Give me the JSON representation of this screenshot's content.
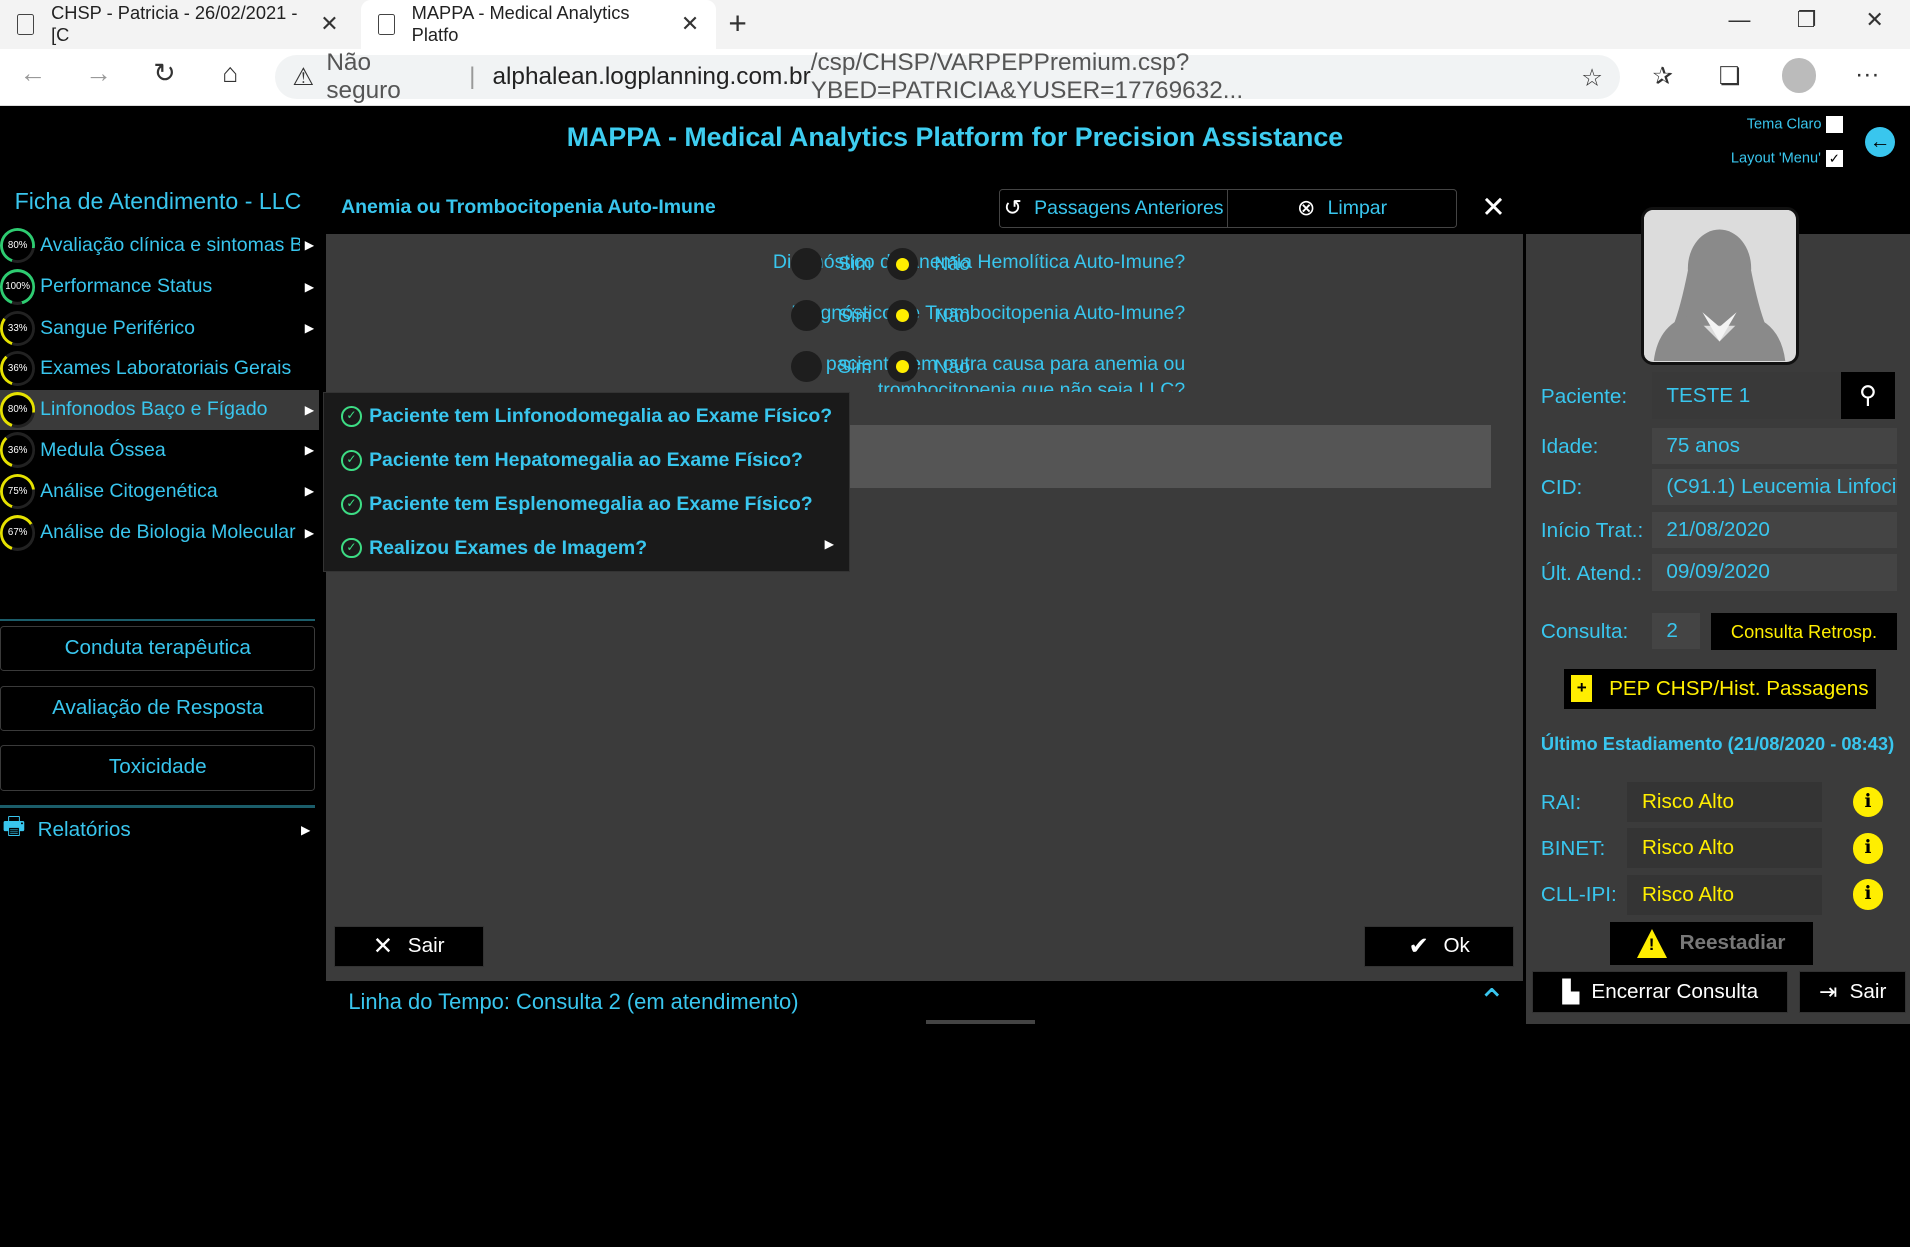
{
  "browser": {
    "tabs": [
      {
        "title": "CHSP - Patricia - 26/02/2021 - [C"
      },
      {
        "title": "MAPPA - Medical Analytics Platfo"
      }
    ],
    "new_tab": "+",
    "minimize": "—",
    "restore": "❐",
    "close": "✕",
    "security": "Não seguro",
    "separator": "|",
    "url_domain": "alphalean.logplanning.com.br",
    "url_path": "/csp/CHSP/VARPEPPremium.csp?YBED=PATRICIA&YUSER=17769632..."
  },
  "app": {
    "title": "MAPPA - Medical Analytics Platform for Precision Assistance",
    "tema_claro": "Tema Claro",
    "layout_menu": "Layout 'Menu'",
    "layout_checked": "✓",
    "accent_color": "#39c6ee",
    "highlight_color": "#ffee00"
  },
  "nav": {
    "title": "Ficha de Atendimento - LLC",
    "items": [
      {
        "pct": "80%",
        "pct_value": 0.8,
        "color": "#2ecc71",
        "label": "Avaliação clínica e sintomas B",
        "arrow": "▶"
      },
      {
        "pct": "100%",
        "pct_value": 1.0,
        "color": "#2ecc71",
        "label": "Performance Status",
        "arrow": "▶"
      },
      {
        "pct": "33%",
        "pct_value": 0.33,
        "color": "#e6e200",
        "label": "Sangue Periférico",
        "arrow": "▶"
      },
      {
        "pct": "36%",
        "pct_value": 0.36,
        "color": "#e6e200",
        "label": "Exames Laboratoriais Gerais",
        "arrow": ""
      },
      {
        "pct": "80%",
        "pct_value": 0.8,
        "color": "#e6e200",
        "label": "Linfonodos Baço e Fígado",
        "arrow": "▶"
      },
      {
        "pct": "36%",
        "pct_value": 0.36,
        "color": "#e6e200",
        "label": "Medula Óssea",
        "arrow": "▶"
      },
      {
        "pct": "75%",
        "pct_value": 0.75,
        "color": "#e6e200",
        "label": "Análise Citogenética",
        "arrow": "▶"
      },
      {
        "pct": "67%",
        "pct_value": 0.67,
        "color": "#e6e200",
        "label": "Análise de Biologia Molecular",
        "arrow": "▶"
      }
    ],
    "buttons": [
      "Conduta terapêutica",
      "Avaliação de Resposta",
      "Toxicidade"
    ],
    "relatorios": "Relatórios",
    "relatorios_arrow": "▶"
  },
  "panel": {
    "title": "Anemia ou Trombocitopenia Auto-Imune",
    "passagens": "Passagens Anteriores",
    "limpar": "Limpar",
    "close": "✕",
    "questions": [
      {
        "text": "Diagnóstico de Anemia Hemolítica Auto-Imune?",
        "yes": "Sim",
        "no": "Não",
        "selected": "Não"
      },
      {
        "text": "Diagnóstico de Trombocitopenia Auto-Imune?",
        "yes": "Sim",
        "no": "Não",
        "selected": "Não"
      },
      {
        "text": "O paciente tem outra causa para anemia ou",
        "text2": "trombocitopenia que não seja LLC?",
        "yes": "Sim",
        "no": "Não",
        "selected": "Não"
      }
    ],
    "submenu": [
      {
        "label": "Paciente tem Linfonodomegalia ao Exame Físico?"
      },
      {
        "label": "Paciente tem Hepatomegalia ao Exame Físico?"
      },
      {
        "label": "Paciente tem Esplenomegalia ao Exame Físico?"
      },
      {
        "label": "Realizou Exames de Imagem?",
        "arrow": "▶"
      }
    ],
    "sair": "Sair",
    "ok": "Ok",
    "timeline": "Linha do Tempo: Consulta 2 (em atendimento)"
  },
  "patient": {
    "paciente_label": "Paciente:",
    "paciente": "TESTE 1",
    "idade_label": "Idade:",
    "idade": "75 anos",
    "cid_label": "CID:",
    "cid": "(C91.1) Leucemia Linfoci",
    "inicio_label": "Início Trat.:",
    "inicio": "21/08/2020",
    "ult_label": "Últ. Atend.:",
    "ult": "09/09/2020",
    "consulta_label": "Consulta:",
    "consulta": "2",
    "consulta_retro": "Consulta Retrosp.",
    "pep": "PEP CHSP/Hist. Passagens",
    "estadiamento": "Último Estadiamento (21/08/2020 - 08:43)",
    "risks": [
      {
        "label": "RAI:",
        "value": "Risco Alto"
      },
      {
        "label": "BINET:",
        "value": "Risco Alto"
      },
      {
        "label": "CLL-IPI:",
        "value": "Risco Alto"
      }
    ],
    "reestadiar": "Reestadiar",
    "encerrar": "Encerrar Consulta",
    "sair": "Sair"
  }
}
